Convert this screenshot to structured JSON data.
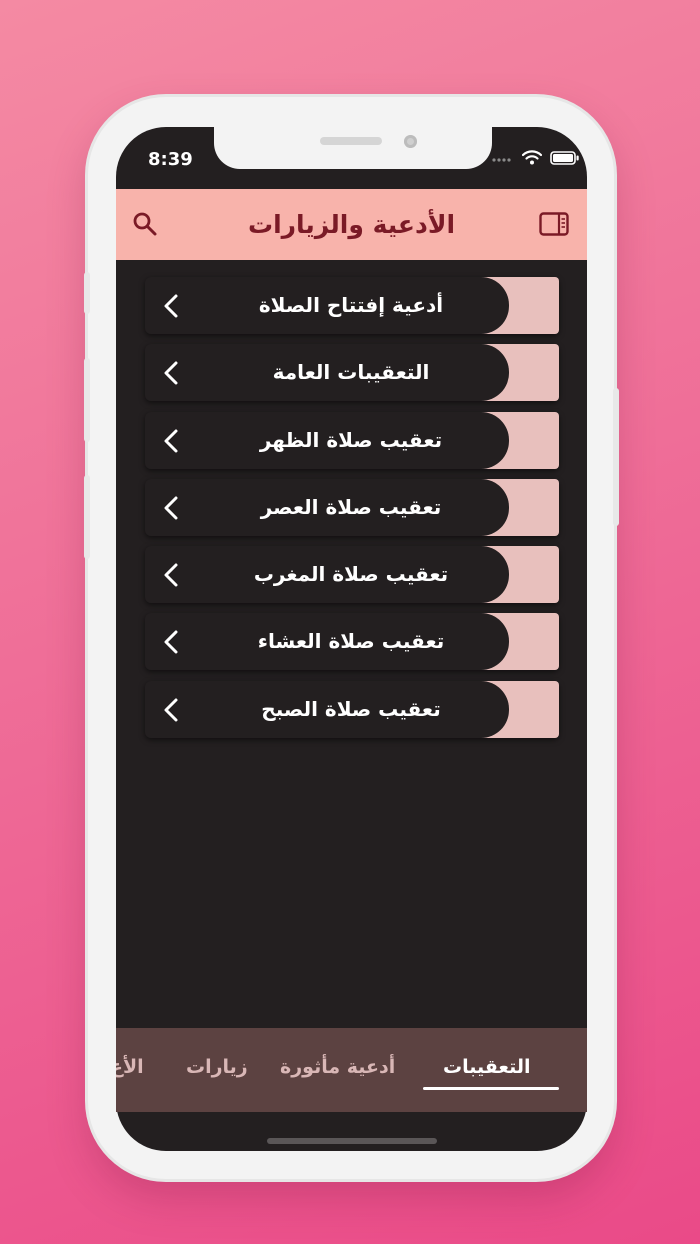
{
  "status_bar": {
    "time": "8:39"
  },
  "header": {
    "title": "الأدعية والزيارات",
    "search_icon": "search-icon",
    "panel_icon": "sidebar-panel-icon",
    "background": "#f8b3ab",
    "title_color": "#7a1a26"
  },
  "list": {
    "items": [
      {
        "label": "أدعية إفتتاح الصلاة"
      },
      {
        "label": "التعقيبات العامة"
      },
      {
        "label": "تعقيب صلاة الظهر"
      },
      {
        "label": "تعقيب صلاة العصر"
      },
      {
        "label": "تعقيب صلاة المغرب"
      },
      {
        "label": "تعقيب صلاة العشاء"
      },
      {
        "label": "تعقيب صلاة الصبح"
      }
    ],
    "accent_color": "#e8c0bd",
    "chevron_icon": "chevron-left-icon"
  },
  "tabs": {
    "items": [
      {
        "label": "التعقيبات",
        "active": true
      },
      {
        "label": "أدعية مأثورة",
        "active": false
      },
      {
        "label": "زيارات",
        "active": false
      },
      {
        "label": "الأع",
        "active": false
      }
    ],
    "background": "#5c4241"
  }
}
